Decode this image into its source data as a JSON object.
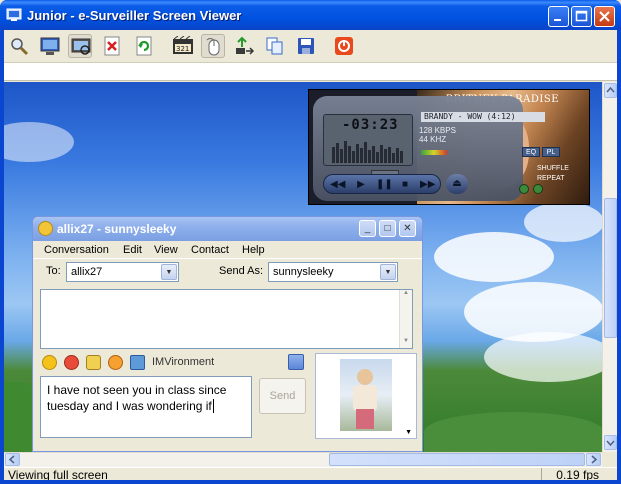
{
  "window": {
    "title": "Junior - e-Surveiller Screen Viewer",
    "minimize_icon": "minimize-icon",
    "maximize_icon": "maximize-icon",
    "close_icon": "close-icon"
  },
  "toolbar": {
    "tools": [
      "zoom-icon",
      "screen-capture-icon",
      "view-screen-icon",
      "delete-icon",
      "refresh-icon",
      "countdown-icon",
      "mouse-icon",
      "upload-icon",
      "copy-icon",
      "save-icon",
      "power-icon"
    ]
  },
  "status": {
    "left": "Viewing full screen",
    "right": "0.19 fps"
  },
  "player": {
    "title": "BRITNEY PARADISE",
    "time": "-03:23",
    "ticker": "BRANDY - WOW (4:12)",
    "kbps": "128",
    "khz": "44",
    "kbps_label": "KBPS",
    "khz_label": "KHZ",
    "eq": "EQ",
    "pl": "PL",
    "shuffle": "SHUFFLE",
    "repeat": "REPEAT"
  },
  "messenger": {
    "title": "allix27 - sunnysleeky",
    "menu": [
      "Conversation",
      "Edit",
      "View",
      "Contact",
      "Help"
    ],
    "to_label": "To:",
    "to_value": "allix27",
    "sendas_label": "Send As:",
    "sendas_value": "sunnysleeky",
    "imvironment": "IMVironment",
    "compose_text": "I have not seen you in class since tuesday and I was wondering if",
    "send_label": "Send"
  }
}
